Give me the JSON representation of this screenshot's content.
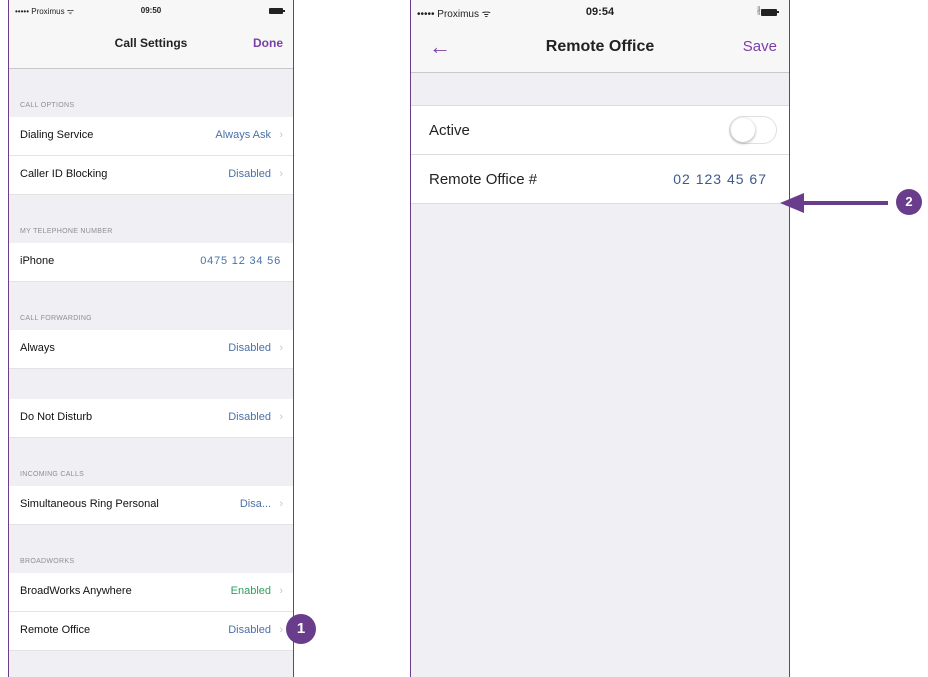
{
  "left": {
    "status": {
      "carrier": "••••• Proximus ᯤ",
      "time": "09:50"
    },
    "nav": {
      "title": "Call Settings",
      "done": "Done"
    },
    "sections": {
      "call_options": "CALL OPTIONS",
      "my_number": "MY TELEPHONE NUMBER",
      "call_forwarding": "CALL FORWARDING",
      "incoming_calls": "INCOMING CALLS",
      "broadworks": "BROADWORKS"
    },
    "rows": {
      "dialing_service": {
        "label": "Dialing Service",
        "value": "Always Ask"
      },
      "caller_id": {
        "label": "Caller ID Blocking",
        "value": "Disabled"
      },
      "iphone": {
        "label": "iPhone",
        "value": "0475 12 34 56"
      },
      "always": {
        "label": "Always",
        "value": "Disabled"
      },
      "dnd": {
        "label": "Do Not Disturb",
        "value": "Disabled"
      },
      "sim_ring": {
        "label": "Simultaneous Ring Personal",
        "value": "Disa..."
      },
      "bw_anywhere": {
        "label": "BroadWorks Anywhere",
        "value": "Enabled"
      },
      "remote_office": {
        "label": "Remote Office",
        "value": "Disabled"
      }
    }
  },
  "right": {
    "status": {
      "carrier": "••••• Proximus ᯤ",
      "time": "09:54",
      "bt": "∦"
    },
    "nav": {
      "back": "←",
      "title": "Remote Office",
      "save": "Save"
    },
    "rows": {
      "active": {
        "label": "Active",
        "toggle_on": false
      },
      "remote_office_number": {
        "label": "Remote Office #",
        "value": "02 123 45 67"
      }
    }
  },
  "callouts": {
    "one": "1",
    "two": "2"
  },
  "icons": {
    "chevron": "›",
    "chevron_icon": "chevron-right-icon",
    "back_icon": "arrow-left-icon"
  },
  "colors": {
    "accent": "#7b3fa6",
    "badge": "#6a3d8c",
    "value_blue": "#4a72a8",
    "enabled_green": "#2ea05a"
  }
}
